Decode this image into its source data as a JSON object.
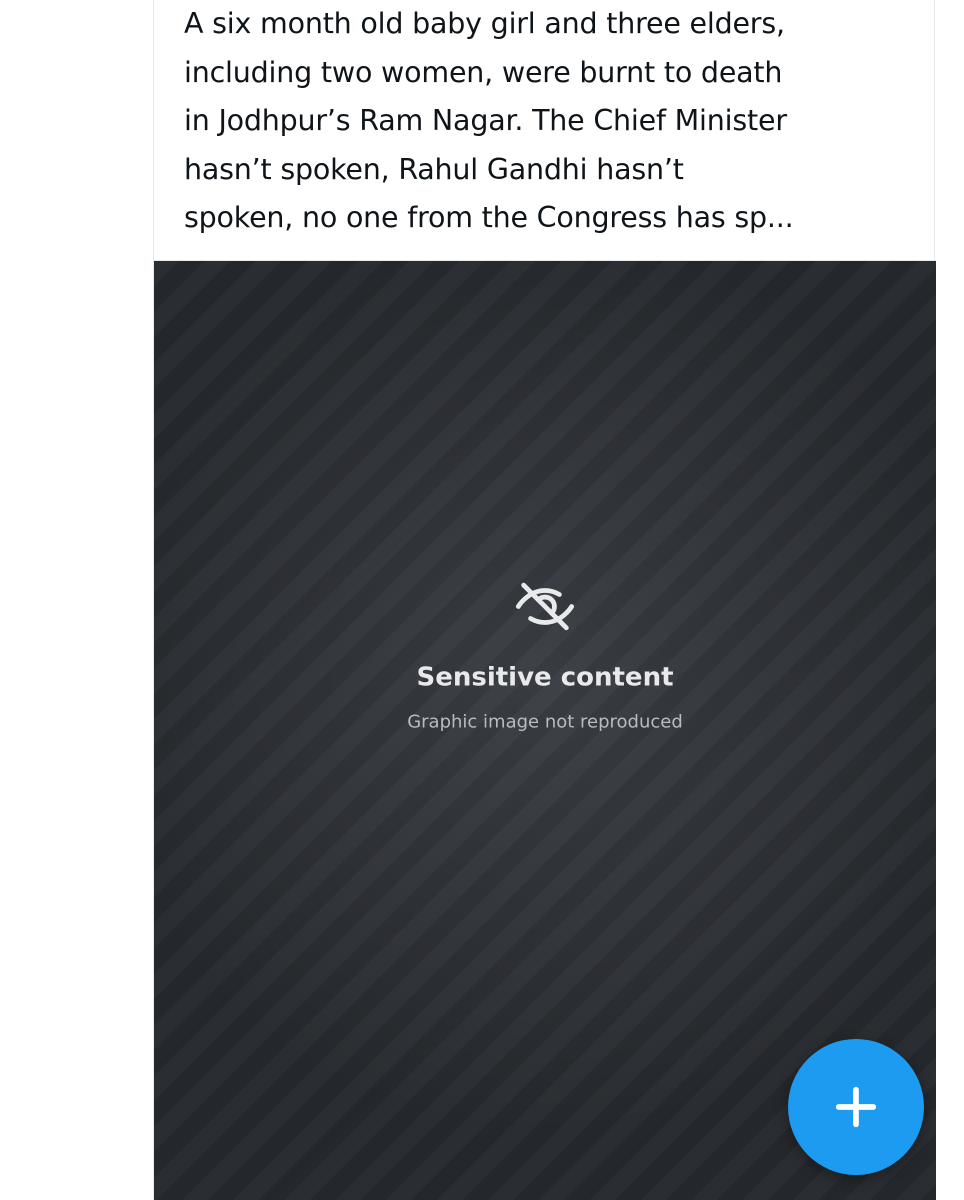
{
  "post": {
    "text": "A six month old baby girl and three elders,\nincluding two women, were burnt to death\nin Jodhpur’s Ram Nagar. The Chief Minister\nhasn’t spoken, Rahul Gandhi hasn’t\nspoken, no one from the Congress has sp..."
  },
  "media": {
    "type": "photo",
    "is_sensitive": true
  },
  "fab": {
    "icon": "plus-icon",
    "color": "#1d9bf0"
  },
  "colors": {
    "text": "#0f1419",
    "accent": "#1d9bf0",
    "divider": "#e7e9ea"
  }
}
